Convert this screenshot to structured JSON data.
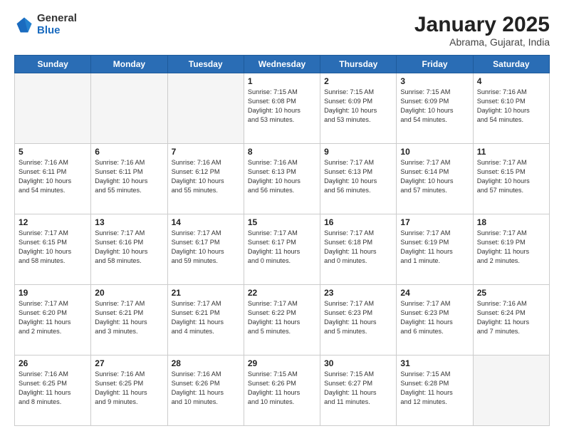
{
  "logo": {
    "general": "General",
    "blue": "Blue"
  },
  "header": {
    "month": "January 2025",
    "location": "Abrama, Gujarat, India"
  },
  "days_of_week": [
    "Sunday",
    "Monday",
    "Tuesday",
    "Wednesday",
    "Thursday",
    "Friday",
    "Saturday"
  ],
  "weeks": [
    [
      {
        "day": "",
        "text": ""
      },
      {
        "day": "",
        "text": ""
      },
      {
        "day": "",
        "text": ""
      },
      {
        "day": "1",
        "text": "Sunrise: 7:15 AM\nSunset: 6:08 PM\nDaylight: 10 hours\nand 53 minutes."
      },
      {
        "day": "2",
        "text": "Sunrise: 7:15 AM\nSunset: 6:09 PM\nDaylight: 10 hours\nand 53 minutes."
      },
      {
        "day": "3",
        "text": "Sunrise: 7:15 AM\nSunset: 6:09 PM\nDaylight: 10 hours\nand 54 minutes."
      },
      {
        "day": "4",
        "text": "Sunrise: 7:16 AM\nSunset: 6:10 PM\nDaylight: 10 hours\nand 54 minutes."
      }
    ],
    [
      {
        "day": "5",
        "text": "Sunrise: 7:16 AM\nSunset: 6:11 PM\nDaylight: 10 hours\nand 54 minutes."
      },
      {
        "day": "6",
        "text": "Sunrise: 7:16 AM\nSunset: 6:11 PM\nDaylight: 10 hours\nand 55 minutes."
      },
      {
        "day": "7",
        "text": "Sunrise: 7:16 AM\nSunset: 6:12 PM\nDaylight: 10 hours\nand 55 minutes."
      },
      {
        "day": "8",
        "text": "Sunrise: 7:16 AM\nSunset: 6:13 PM\nDaylight: 10 hours\nand 56 minutes."
      },
      {
        "day": "9",
        "text": "Sunrise: 7:17 AM\nSunset: 6:13 PM\nDaylight: 10 hours\nand 56 minutes."
      },
      {
        "day": "10",
        "text": "Sunrise: 7:17 AM\nSunset: 6:14 PM\nDaylight: 10 hours\nand 57 minutes."
      },
      {
        "day": "11",
        "text": "Sunrise: 7:17 AM\nSunset: 6:15 PM\nDaylight: 10 hours\nand 57 minutes."
      }
    ],
    [
      {
        "day": "12",
        "text": "Sunrise: 7:17 AM\nSunset: 6:15 PM\nDaylight: 10 hours\nand 58 minutes."
      },
      {
        "day": "13",
        "text": "Sunrise: 7:17 AM\nSunset: 6:16 PM\nDaylight: 10 hours\nand 58 minutes."
      },
      {
        "day": "14",
        "text": "Sunrise: 7:17 AM\nSunset: 6:17 PM\nDaylight: 10 hours\nand 59 minutes."
      },
      {
        "day": "15",
        "text": "Sunrise: 7:17 AM\nSunset: 6:17 PM\nDaylight: 11 hours\nand 0 minutes."
      },
      {
        "day": "16",
        "text": "Sunrise: 7:17 AM\nSunset: 6:18 PM\nDaylight: 11 hours\nand 0 minutes."
      },
      {
        "day": "17",
        "text": "Sunrise: 7:17 AM\nSunset: 6:19 PM\nDaylight: 11 hours\nand 1 minute."
      },
      {
        "day": "18",
        "text": "Sunrise: 7:17 AM\nSunset: 6:19 PM\nDaylight: 11 hours\nand 2 minutes."
      }
    ],
    [
      {
        "day": "19",
        "text": "Sunrise: 7:17 AM\nSunset: 6:20 PM\nDaylight: 11 hours\nand 2 minutes."
      },
      {
        "day": "20",
        "text": "Sunrise: 7:17 AM\nSunset: 6:21 PM\nDaylight: 11 hours\nand 3 minutes."
      },
      {
        "day": "21",
        "text": "Sunrise: 7:17 AM\nSunset: 6:21 PM\nDaylight: 11 hours\nand 4 minutes."
      },
      {
        "day": "22",
        "text": "Sunrise: 7:17 AM\nSunset: 6:22 PM\nDaylight: 11 hours\nand 5 minutes."
      },
      {
        "day": "23",
        "text": "Sunrise: 7:17 AM\nSunset: 6:23 PM\nDaylight: 11 hours\nand 5 minutes."
      },
      {
        "day": "24",
        "text": "Sunrise: 7:17 AM\nSunset: 6:23 PM\nDaylight: 11 hours\nand 6 minutes."
      },
      {
        "day": "25",
        "text": "Sunrise: 7:16 AM\nSunset: 6:24 PM\nDaylight: 11 hours\nand 7 minutes."
      }
    ],
    [
      {
        "day": "26",
        "text": "Sunrise: 7:16 AM\nSunset: 6:25 PM\nDaylight: 11 hours\nand 8 minutes."
      },
      {
        "day": "27",
        "text": "Sunrise: 7:16 AM\nSunset: 6:25 PM\nDaylight: 11 hours\nand 9 minutes."
      },
      {
        "day": "28",
        "text": "Sunrise: 7:16 AM\nSunset: 6:26 PM\nDaylight: 11 hours\nand 10 minutes."
      },
      {
        "day": "29",
        "text": "Sunrise: 7:15 AM\nSunset: 6:26 PM\nDaylight: 11 hours\nand 10 minutes."
      },
      {
        "day": "30",
        "text": "Sunrise: 7:15 AM\nSunset: 6:27 PM\nDaylight: 11 hours\nand 11 minutes."
      },
      {
        "day": "31",
        "text": "Sunrise: 7:15 AM\nSunset: 6:28 PM\nDaylight: 11 hours\nand 12 minutes."
      },
      {
        "day": "",
        "text": ""
      }
    ]
  ]
}
